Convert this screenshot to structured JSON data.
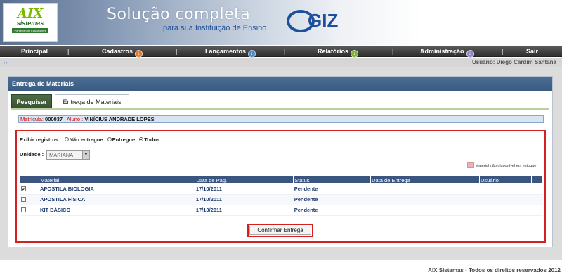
{
  "header": {
    "logo_name": "AIX",
    "logo_sub": "sistemas",
    "logo_tagline": "Parceria dos Educadores",
    "slogan_line1": "Solução completa",
    "slogan_line2": "para sua Instituição de Ensino",
    "brand_suffix": "GIZ"
  },
  "nav": {
    "items": [
      {
        "label": "Principal"
      },
      {
        "label": "Cadastros",
        "icon": "down-icon",
        "color": "#e2772a"
      },
      {
        "label": "Lançamentos",
        "icon": "down-icon",
        "color": "#4e87c8"
      },
      {
        "label": "Relatórios",
        "icon": "down-icon",
        "color": "#7fb32d"
      },
      {
        "label": "Administração",
        "icon": "down-icon",
        "color": "#8a86c8"
      },
      {
        "label": "Sair"
      }
    ],
    "separator": "|"
  },
  "userbar": {
    "user_label": "Usuário: Diego Cardim Santana"
  },
  "panel": {
    "title": "Entrega de Materiais",
    "tabs": [
      {
        "label": "Pesquisar"
      },
      {
        "label": "Entrega de Materiais"
      }
    ]
  },
  "student": {
    "matricula_label": "Matrícula:",
    "matricula_value": "000037",
    "aluno_label": "Aluno :",
    "aluno_value": "VINÍCIUS ANDRADE LOPES"
  },
  "filters": {
    "exibir_label": "Exibir registros:",
    "options": [
      "Não entregue",
      "Entregue",
      "Todos"
    ],
    "selected": "Todos",
    "unidade_label": "Unidade :",
    "unidade_value": "MARIANA"
  },
  "legend": {
    "text": "Material não disponível em estoque.",
    "color": "#f0b0b5"
  },
  "table": {
    "columns": [
      "",
      "Material",
      "Data de Pag.",
      "Status",
      "Data de Entrega",
      "Usuário",
      ""
    ],
    "rows": [
      {
        "checked": true,
        "material": "APOSTILA BIOLOGIA",
        "data_pag": "17/10/2011",
        "status": "Pendente",
        "data_entrega": "",
        "usuario": ""
      },
      {
        "checked": false,
        "material": "APOSTILA FÍSICA",
        "data_pag": "17/10/2011",
        "status": "Pendente",
        "data_entrega": "",
        "usuario": ""
      },
      {
        "checked": false,
        "material": "KIT BÁSICO",
        "data_pag": "17/10/2011",
        "status": "Pendente",
        "data_entrega": "",
        "usuario": ""
      }
    ]
  },
  "actions": {
    "confirm_label": "Confirmar Entrega"
  },
  "footer": {
    "text": "AIX Sistemas - Todos os direitos reservados 2012"
  }
}
